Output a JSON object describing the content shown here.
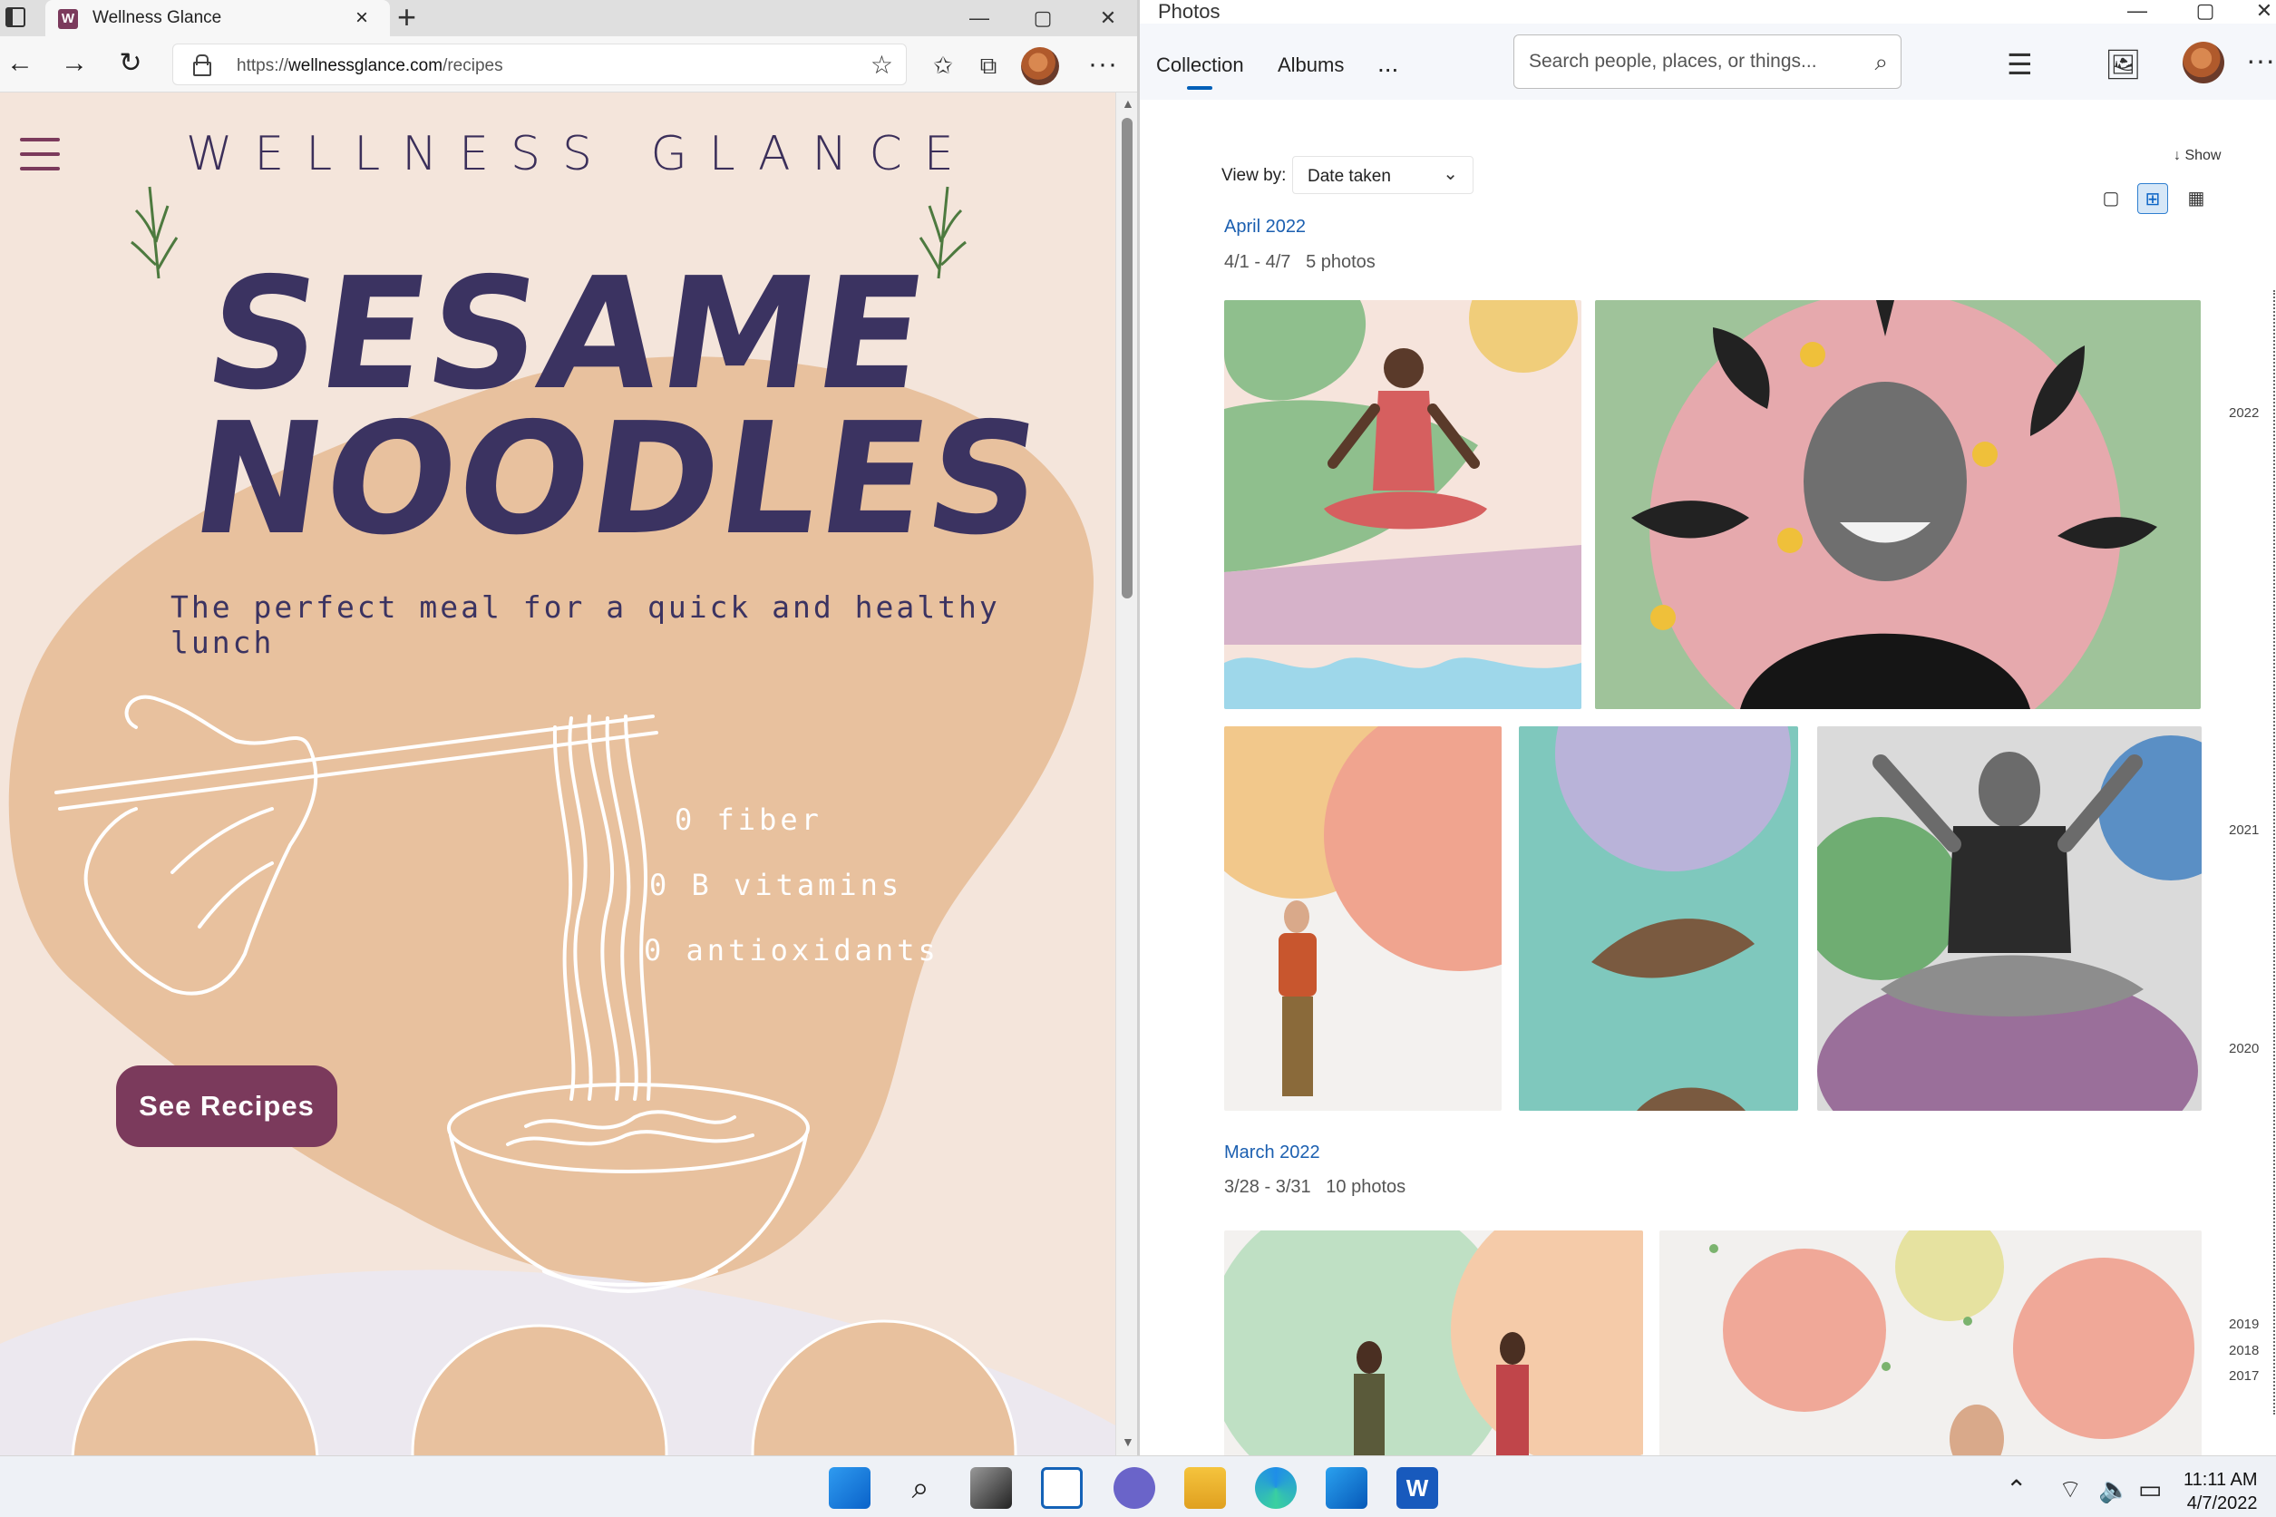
{
  "browser": {
    "tab_title": "Wellness Glance",
    "favicon_letter": "W",
    "url_prefix": "https://",
    "url_host": "wellnessglance.com",
    "url_path": "/recipes"
  },
  "website": {
    "brand": "WELLNESS GLANCE",
    "hero_line1": "SESAME",
    "hero_line2": "NOODLES",
    "tagline": "The perfect meal for a quick and healthy lunch",
    "benefits": [
      "0 fiber",
      "0 B vitamins",
      "0 antioxidants"
    ],
    "cta_label": "See Recipes"
  },
  "photos": {
    "app_title": "Photos",
    "tabs": [
      "Collection",
      "Albums"
    ],
    "more": "...",
    "search_placeholder": "Search people, places, or things...",
    "view_by_label": "View by:",
    "view_by_value": "Date taken",
    "show_label": "Show",
    "groups": [
      {
        "month": "April 2022",
        "range": "4/1 - 4/7",
        "count": "5 photos"
      },
      {
        "month": "March 2022",
        "range": "3/28 - 3/31",
        "count": "10 photos"
      }
    ],
    "timeline_years": [
      "2022",
      "2021",
      "2020",
      "2019",
      "2018",
      "2017"
    ]
  },
  "taskbar": {
    "time": "11:11 AM",
    "date": "4/7/2022"
  },
  "colors": {
    "brand_plum": "#7b3a5c",
    "hero_navy": "#3b3361",
    "peach_bg": "#f4e5db",
    "peach_blob": "#e8c19e",
    "photos_accent": "#005fb8"
  }
}
